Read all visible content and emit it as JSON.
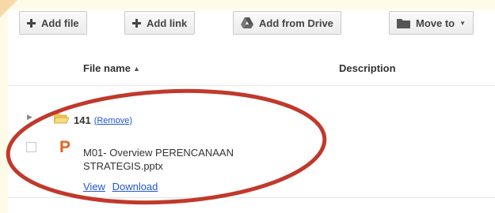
{
  "toolbar": {
    "add_file": "Add file",
    "add_link": "Add link",
    "add_from_drive": "Add from Drive",
    "move_to": "Move to"
  },
  "table": {
    "headers": {
      "file_name": "File name",
      "description": "Description"
    }
  },
  "folder": {
    "name": "141",
    "remove_link": "(Remove)"
  },
  "file": {
    "name": "M01- Overview PERENCANAAN STRATEGIS.pptx",
    "view_link": "View",
    "download_link": "Download"
  },
  "colors": {
    "link": "#2255cc",
    "annotation_oval": "#c0392b",
    "file_icon": "#e8621f",
    "background": "#fffbe6"
  },
  "icons": [
    "plus-icon",
    "drive-icon",
    "folder-icon",
    "chevron-down-icon",
    "folder-open-icon",
    "presentation-file-icon",
    "sort-ascending-icon",
    "expand-arrow-icon"
  ]
}
